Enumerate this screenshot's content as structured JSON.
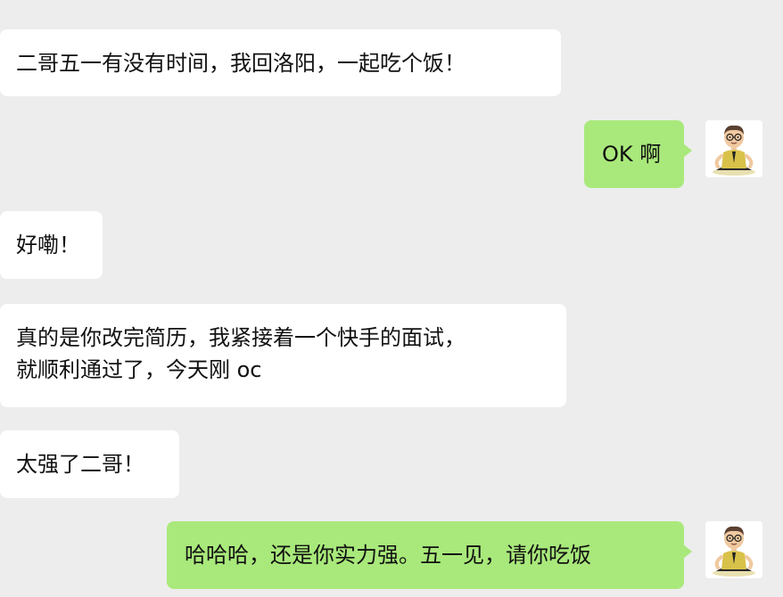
{
  "messages": [
    {
      "side": "left",
      "lines": [
        "二哥五一有没有时间，我回洛阳，一起吃个饭！"
      ]
    },
    {
      "side": "right",
      "lines": [
        "OK 啊"
      ]
    },
    {
      "side": "left",
      "lines": [
        "好嘞！"
      ]
    },
    {
      "side": "left",
      "lines": [
        "真的是你改完简历，我紧接着一个快手的面试，",
        "就顺利通过了，今天刚 oc"
      ]
    },
    {
      "side": "left",
      "lines": [
        "太强了二哥！"
      ]
    },
    {
      "side": "right",
      "lines": [
        "哈哈哈，还是你实力强。五一见，请你吃饭"
      ]
    }
  ],
  "avatar_icon": "meditating-cartoon-man-avatar-icon",
  "colors": {
    "background": "#ededed",
    "incoming_bubble": "#ffffff",
    "outgoing_bubble": "#a9e97b"
  }
}
